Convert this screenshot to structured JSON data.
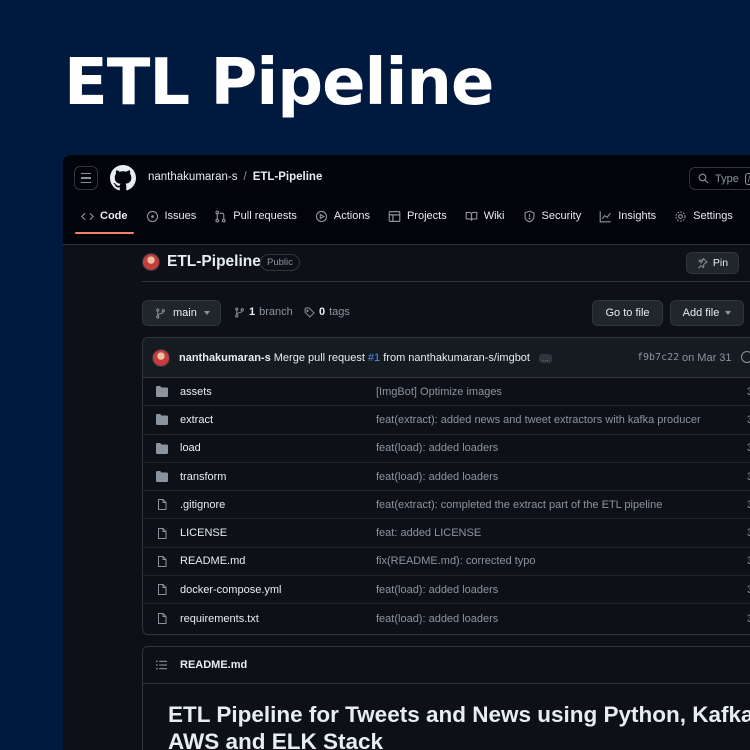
{
  "hero": {
    "title": "ETL Pipeline"
  },
  "header": {
    "owner": "nanthakumaran-s",
    "separator": "/",
    "repo": "ETL-Pipeline",
    "search_placeholder": "Type",
    "search_key": "/"
  },
  "tabs": [
    {
      "label": "Code",
      "icon": "code-icon",
      "active": true
    },
    {
      "label": "Issues",
      "icon": "issue-icon"
    },
    {
      "label": "Pull requests",
      "icon": "pull-request-icon"
    },
    {
      "label": "Actions",
      "icon": "play-icon"
    },
    {
      "label": "Projects",
      "icon": "table-icon"
    },
    {
      "label": "Wiki",
      "icon": "book-icon"
    },
    {
      "label": "Security",
      "icon": "shield-icon"
    },
    {
      "label": "Insights",
      "icon": "graph-icon"
    },
    {
      "label": "Settings",
      "icon": "gear-icon"
    }
  ],
  "repo_header": {
    "name": "ETL-Pipeline",
    "visibility": "Public",
    "pin_label": "Pin"
  },
  "toolbar": {
    "branch": "main",
    "branch_count": "1",
    "branch_label": "branch",
    "tag_count": "0",
    "tag_label": "tags",
    "go_to_file": "Go to file",
    "add_file": "Add file"
  },
  "last_commit": {
    "author": "nanthakumaran-s",
    "message_pre": "Merge pull request",
    "pr": "#1",
    "message_post": "from nanthakumaran-s/imgbot",
    "ellipsis": "...",
    "sha": "f9b7c22",
    "date": "on Mar 31"
  },
  "files": [
    {
      "name": "assets",
      "type": "dir",
      "commit": "[ImgBot] Optimize images",
      "time": "3"
    },
    {
      "name": "extract",
      "type": "dir",
      "commit": "feat(extract): added news and tweet extractors with kafka producer",
      "time": "3"
    },
    {
      "name": "load",
      "type": "dir",
      "commit": "feat(load): added loaders",
      "time": "3"
    },
    {
      "name": "transform",
      "type": "dir",
      "commit": "feat(load): added loaders",
      "time": "3"
    },
    {
      "name": ".gitignore",
      "type": "file",
      "commit": "feat(extract): completed the extract part of the ETL pipeline",
      "time": "3"
    },
    {
      "name": "LICENSE",
      "type": "file",
      "commit": "feat: added LICENSE",
      "time": "3"
    },
    {
      "name": "README.md",
      "type": "file",
      "commit": "fix(README.md): corrected typo",
      "time": "3"
    },
    {
      "name": "docker-compose.yml",
      "type": "file",
      "commit": "feat(load): added loaders",
      "time": "3"
    },
    {
      "name": "requirements.txt",
      "type": "file",
      "commit": "feat(load): added loaders",
      "time": "3"
    }
  ],
  "readme": {
    "label": "README.md",
    "heading": "ETL Pipeline for Tweets and News using Python, Kafka, AWS and ELK Stack"
  },
  "colors": {
    "background": "#001a3f",
    "window": "#0d1117",
    "accent": "#f78166",
    "link": "#4493f8",
    "folder": "#8b949e"
  }
}
